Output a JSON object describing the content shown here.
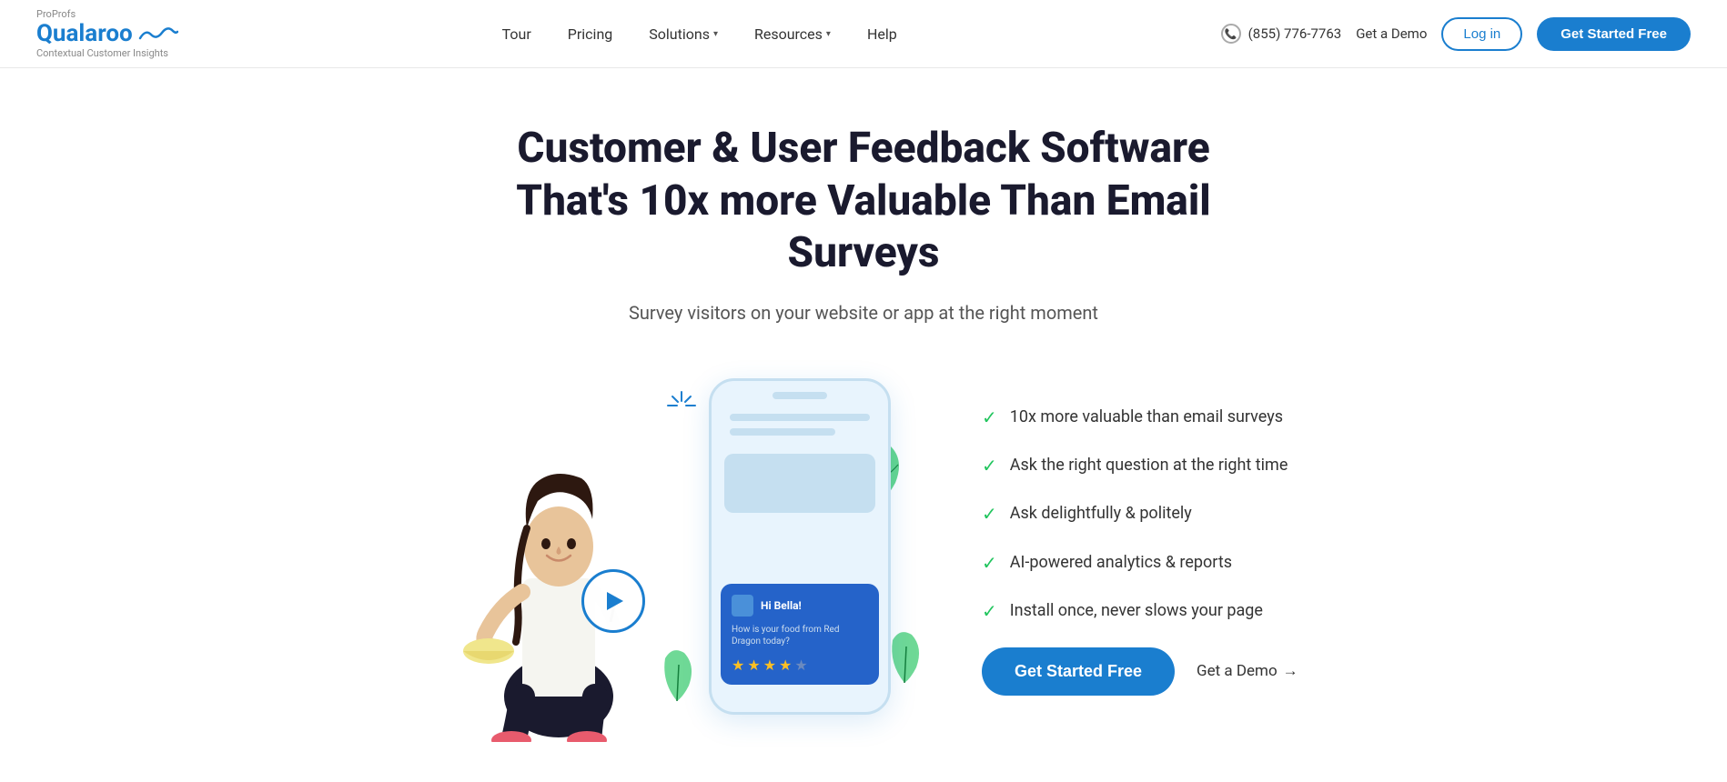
{
  "brand": {
    "proprofs_label": "ProProfs",
    "logo_text": "Qualaroo",
    "tagline": "Contextual Customer Insights"
  },
  "nav": {
    "tour": "Tour",
    "pricing": "Pricing",
    "solutions": "Solutions",
    "resources": "Resources",
    "help": "Help"
  },
  "header": {
    "phone": "(855) 776-7763",
    "get_demo": "Get a Demo",
    "login": "Log in",
    "cta": "Get Started Free"
  },
  "hero": {
    "title": "Customer & User Feedback Software That's 10x more Valuable Than Email Surveys",
    "subtitle": "Survey visitors on your website or app at the right moment",
    "cta_button": "Get Started Free",
    "demo_link": "Get a Demo"
  },
  "features": [
    {
      "text": "10x more valuable than email surveys"
    },
    {
      "text": "Ask the right question at the right time"
    },
    {
      "text": "Ask delightfully & politely"
    },
    {
      "text": "AI-powered analytics & reports"
    },
    {
      "text": "Install once, never slows your page"
    }
  ],
  "survey_widget": {
    "greeting": "Hi Bella!",
    "question": "How is your food from Red Dragon today?",
    "stars": [
      true,
      true,
      true,
      true,
      false
    ]
  }
}
